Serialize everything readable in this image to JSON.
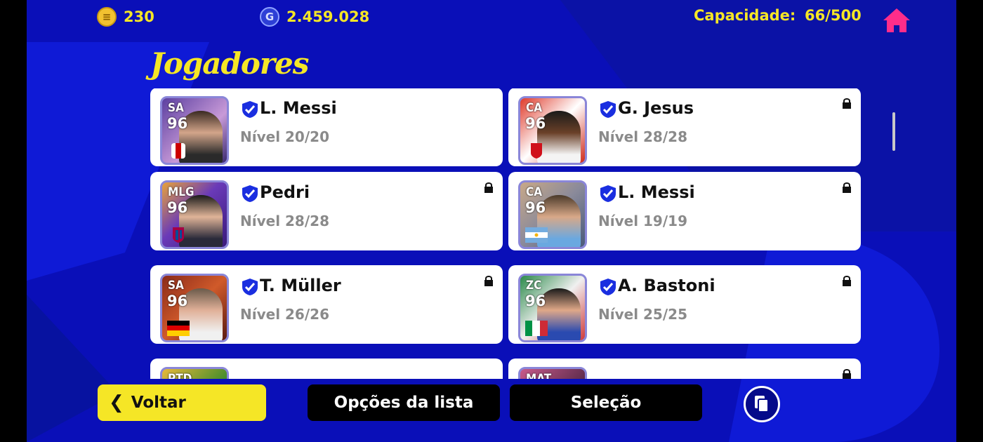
{
  "header": {
    "coins_e": "230",
    "coins_g": "2.459.028",
    "capacity_label": "Capacidade:",
    "capacity_value": "66/500",
    "title": "Jogadores"
  },
  "players": [
    {
      "position": "SA",
      "rating": "96",
      "name": "L. Messi",
      "level": "Nível 20/20",
      "locked": false
    },
    {
      "position": "CA",
      "rating": "96",
      "name": "G. Jesus",
      "level": "Nível 28/28",
      "locked": true
    },
    {
      "position": "MLG",
      "rating": "96",
      "name": "Pedri",
      "level": "Nível 28/28",
      "locked": true
    },
    {
      "position": "CA",
      "rating": "96",
      "name": "L. Messi",
      "level": "Nível 19/19",
      "locked": true
    },
    {
      "position": "SA",
      "rating": "96",
      "name": "T. Müller",
      "level": "Nível 26/26",
      "locked": true
    },
    {
      "position": "ZC",
      "rating": "96",
      "name": "A. Bastoni",
      "level": "Nível 25/25",
      "locked": true
    },
    {
      "position": "PTD",
      "rating": "",
      "name": "",
      "level": "",
      "locked": false
    },
    {
      "position": "MAT",
      "rating": "",
      "name": "",
      "level": "",
      "locked": true
    }
  ],
  "footer": {
    "back_label": "Voltar",
    "list_options_label": "Opções da lista",
    "selection_label": "Seleção"
  },
  "colors": {
    "accent": "#f5e626",
    "background": "#0a0fb8",
    "home": "#ff2d8a"
  }
}
